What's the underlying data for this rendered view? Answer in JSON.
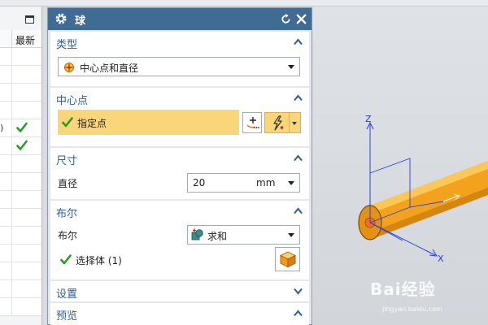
{
  "left_panel": {
    "column_header": "最新",
    "rows": [
      {
        "paren": "",
        "check": false
      },
      {
        "paren": "",
        "check": false
      },
      {
        "paren": "",
        "check": false
      },
      {
        "paren": "",
        "check": false
      },
      {
        "paren": ")",
        "check": true
      },
      {
        "paren": "",
        "check": true
      },
      {
        "paren": "",
        "check": false
      },
      {
        "paren": "",
        "check": false
      },
      {
        "paren": "",
        "check": false
      },
      {
        "paren": "",
        "check": false
      },
      {
        "paren": "",
        "check": false
      },
      {
        "paren": "",
        "check": false
      },
      {
        "paren": "",
        "check": false
      },
      {
        "paren": "",
        "check": false
      },
      {
        "paren": "",
        "check": false
      }
    ]
  },
  "dialog": {
    "title": "球",
    "type_section": {
      "title": "类型",
      "dropdown_value": "中心点和直径"
    },
    "center_section": {
      "title": "中心点",
      "specify_point_label": "指定点"
    },
    "size_section": {
      "title": "尺寸",
      "diameter_label": "直径",
      "diameter_value": "20",
      "unit": "mm"
    },
    "boolean_section": {
      "title": "布尔",
      "boolean_label": "布尔",
      "boolean_value": "求和",
      "select_body_label": "选择体 (1)"
    },
    "settings_section": {
      "title": "设置"
    },
    "preview_section": {
      "title": "预览"
    }
  },
  "viewport": {
    "axis_labels": {
      "z": "Z",
      "x": "X"
    }
  },
  "watermark": {
    "text": "Bai经验",
    "sub": "jingyan.baidu.com"
  },
  "colors": {
    "titlebar": "#3f6b94",
    "section_title": "#2e5f8f",
    "highlight": "#fad67a",
    "check": "#2a9a2a",
    "cylinder": "#f2a21c"
  }
}
